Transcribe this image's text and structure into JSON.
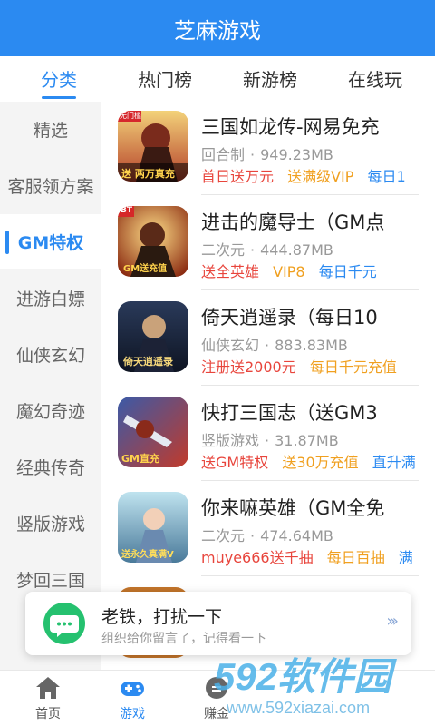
{
  "app": {
    "title": "芝麻游戏"
  },
  "tabs": [
    {
      "label": "分类"
    },
    {
      "label": "热门榜"
    },
    {
      "label": "新游榜"
    },
    {
      "label": "在线玩"
    }
  ],
  "sidebar": {
    "items": [
      {
        "label": "精选"
      },
      {
        "label": "客服领方案"
      },
      {
        "label": "GM特权"
      },
      {
        "label": "进游白嫖"
      },
      {
        "label": "仙侠玄幻"
      },
      {
        "label": "魔幻奇迹"
      },
      {
        "label": "经典传奇"
      },
      {
        "label": "竖版游戏"
      },
      {
        "label": "梦回三国"
      }
    ]
  },
  "games": [
    {
      "title": "三国如龙传-网易免充",
      "genre": "回合制",
      "size": "949.23MB",
      "tags": [
        {
          "text": "首日送万元",
          "color": "red"
        },
        {
          "text": "送满级VIP",
          "color": "orange"
        },
        {
          "text": "每日1",
          "color": "blue"
        }
      ],
      "icon_badge": "送 两万真充",
      "icon_corner": "无门槛"
    },
    {
      "title": "进击的魔导士（GM点",
      "genre": "二次元",
      "size": "444.87MB",
      "tags": [
        {
          "text": "送全英雄",
          "color": "red"
        },
        {
          "text": "VIP8",
          "color": "orange"
        },
        {
          "text": "每日千元",
          "color": "blue"
        }
      ],
      "icon_badge": "GM送充值",
      "icon_corner": "BT"
    },
    {
      "title": "倚天逍遥录（每日10",
      "genre": "仙侠玄幻",
      "size": "883.83MB",
      "tags": [
        {
          "text": "注册送2000元",
          "color": "red"
        },
        {
          "text": "每日千元充值",
          "color": "orange"
        }
      ],
      "icon_badge": "倚天逍遥录",
      "icon_corner": ""
    },
    {
      "title": "快打三国志（送GM3",
      "genre": "竖版游戏",
      "size": "31.87MB",
      "tags": [
        {
          "text": "送GM特权",
          "color": "red"
        },
        {
          "text": "送30万充值",
          "color": "orange"
        },
        {
          "text": "直升满",
          "color": "blue"
        }
      ],
      "icon_badge": "GM直充",
      "icon_corner": ""
    },
    {
      "title": "你来嘛英雄（GM全免",
      "genre": "二次元",
      "size": "474.64MB",
      "tags": [
        {
          "text": "muye666送千抽",
          "color": "red"
        },
        {
          "text": "每日百抽",
          "color": "orange"
        },
        {
          "text": "满",
          "color": "blue"
        }
      ],
      "icon_badge": "送永久真满V",
      "icon_corner": ""
    }
  ],
  "notice": {
    "title": "老铁，打扰一下",
    "subtitle": "组织给你留言了，记得看一下",
    "arrows": "›››"
  },
  "bottom_nav": [
    {
      "label": "首页",
      "icon": "home-icon"
    },
    {
      "label": "游戏",
      "icon": "gamepad-icon"
    },
    {
      "label": "赚金",
      "icon": "coin-icon"
    },
    {
      "label": "",
      "icon": ""
    },
    {
      "label": "",
      "icon": ""
    }
  ],
  "watermark": {
    "text": "592软件园",
    "url": "www.592xiazai.com"
  },
  "colors": {
    "primary": "#2b8af1",
    "red": "#e8453c",
    "orange": "#f0a020",
    "notice_green": "#25c16f"
  }
}
